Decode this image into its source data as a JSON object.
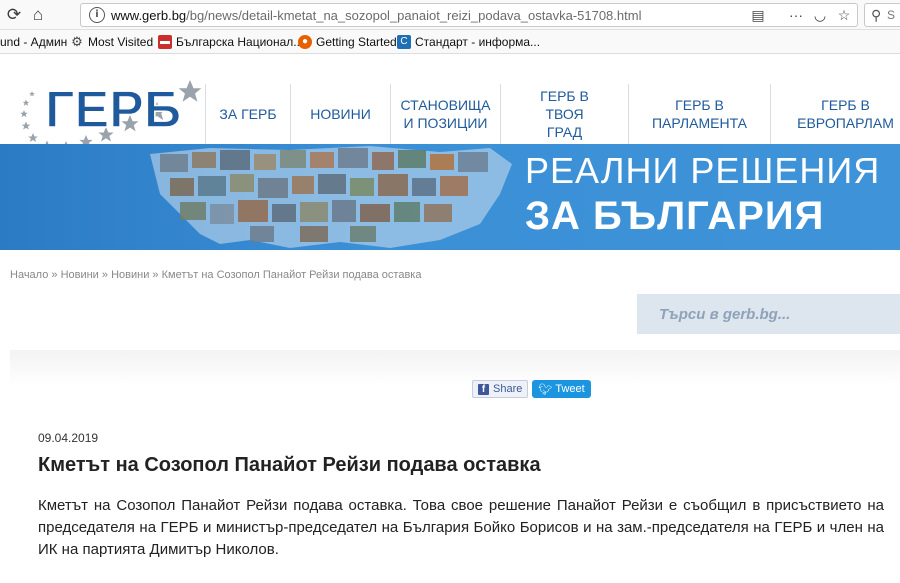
{
  "browser": {
    "url_domain": "www.gerb.bg",
    "url_path": "/bg/news/detail-kmetat_na_sozopol_panaiot_reizi_podava_ostavka-51708.html",
    "search_placeholder": "S",
    "bookmarks": [
      {
        "label": "und - Админ",
        "icon": "page-icon"
      },
      {
        "label": "Most Visited",
        "icon": "gear-icon"
      },
      {
        "label": "Българска Национал...",
        "icon": "bnt-icon"
      },
      {
        "label": "Getting Started",
        "icon": "firefox-icon"
      },
      {
        "label": "Стандарт - информа...",
        "icon": "standart-icon"
      }
    ]
  },
  "site": {
    "logo_text": "ГЕРБ",
    "menu": [
      {
        "label": "ЗА ГЕРБ"
      },
      {
        "label": "НОВИНИ"
      },
      {
        "label": "СТАНОВИЩА И ПОЗИЦИИ"
      },
      {
        "label": "ГЕРБ В ТВОЯ ГРАД"
      },
      {
        "label": "ГЕРБ В ПАРЛАМЕНТА"
      },
      {
        "label": "ГЕРБ В ЕВРОПАРЛАМ"
      }
    ],
    "banner": {
      "line1": "РЕАЛНИ РЕШЕНИЯ",
      "line2": "ЗА БЪЛГАРИЯ"
    },
    "breadcrumb": {
      "home": "Начало",
      "sep": " » ",
      "news1": "Новини",
      "news2": "Новини",
      "current": "Кметът на Созопол Панайот Рейзи подава оставка"
    },
    "search_placeholder": "Търси в gerb.bg..."
  },
  "article": {
    "share_label": "Share",
    "tweet_label": "Tweet",
    "date": "09.04.2019",
    "title": "Кметът на Созопол Панайот Рейзи подава оставка",
    "body": "Кметът на Созопол Панайот Рейзи подава оставка. Това свое решение Панайот Рейзи е съобщил в присъствието на председателя на ГЕРБ и министър-председател на България Бойко Борисов и на зам.-председателя на ГЕРБ и член на ИК на партията Димитър Николов."
  },
  "colors": {
    "brand_blue": "#1f5a9c",
    "banner_blue": "#3a8fd6",
    "facebook": "#3b5998",
    "twitter": "#1b95e0"
  }
}
